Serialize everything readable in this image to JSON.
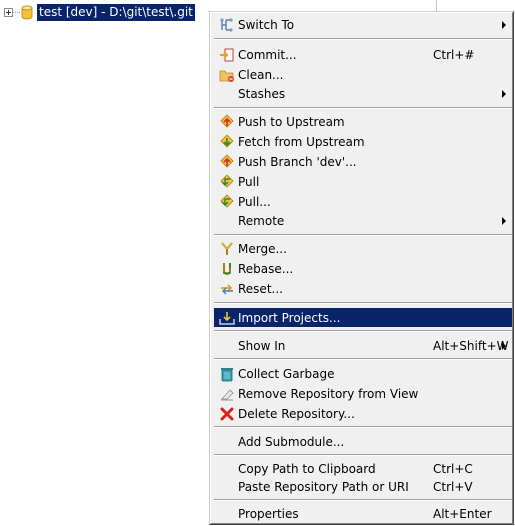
{
  "tree": {
    "repo_label": "test [dev] - D:\\git\\test\\.git"
  },
  "menu": {
    "switch_to": "Switch To",
    "commit": "Commit...",
    "commit_accel": "Ctrl+#",
    "clean": "Clean...",
    "stashes": "Stashes",
    "push_upstream": "Push to Upstream",
    "fetch_upstream": "Fetch from Upstream",
    "push_branch": "Push Branch 'dev'...",
    "pull": "Pull",
    "pull_dialog": "Pull...",
    "remote": "Remote",
    "merge": "Merge...",
    "rebase": "Rebase...",
    "reset": "Reset...",
    "import_projects": "Import Projects...",
    "show_in": "Show In",
    "show_in_accel": "Alt+Shift+W",
    "collect_garbage": "Collect Garbage",
    "remove_repo": "Remove Repository from View",
    "delete_repo": "Delete Repository...",
    "add_submodule": "Add Submodule...",
    "copy_path": "Copy Path to Clipboard",
    "copy_path_accel": "Ctrl+C",
    "paste_path": "Paste Repository Path or URI",
    "paste_path_accel": "Ctrl+V",
    "properties": "Properties",
    "properties_accel": "Alt+Enter"
  },
  "colors": {
    "selection": "#0a246a",
    "menu_bg": "#f0f0f0"
  }
}
